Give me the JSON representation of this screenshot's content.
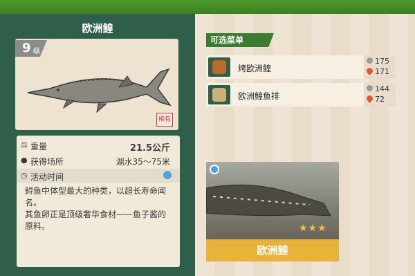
{
  "fish": {
    "name": "欧洲鳇",
    "level": "9",
    "level_unit": "级",
    "stamp_text": "稀有"
  },
  "details": {
    "weight_label": "重量",
    "weight_value": "21.5公斤",
    "location_label": "获得场所",
    "location_value": "湖水35～75米",
    "time_label": "活动时间",
    "description": "鲟鱼中体型最大的种类，以超长寿命闻名。\n其鱼卵正是顶级奢华食材——鱼子酱的原料。"
  },
  "menu": {
    "title": "可选菜单",
    "items": [
      {
        "name": "烤欧洲鳇",
        "cost_a": "175",
        "cost_b": "171",
        "icon": "roast-dish-icon"
      },
      {
        "name": "欧洲鳇鱼排",
        "cost_a": "144",
        "cost_b": "72",
        "icon": "fish-steak-icon"
      }
    ]
  },
  "photo": {
    "caption": "欧洲鳇",
    "stars": "★★★"
  },
  "colors": {
    "panel_green": "#2f5f4b",
    "menu_green": "#3c7c32",
    "banner_gold": "#e8b33a"
  }
}
